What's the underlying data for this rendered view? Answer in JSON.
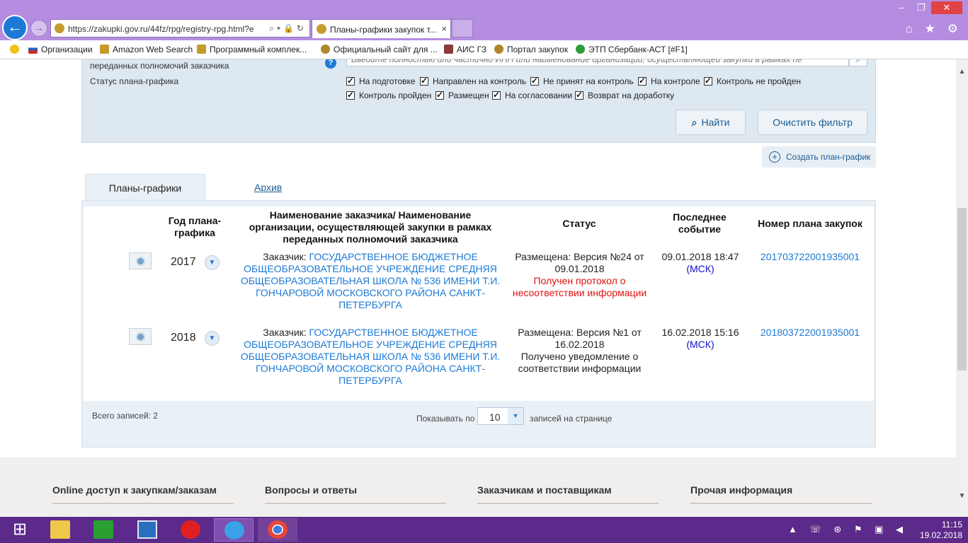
{
  "browser": {
    "url": "https://zakupki.gov.ru/44fz/rpg/registry-rpg.html?е",
    "tab_title": "Планы-графики закупок т...",
    "tab_close": "×",
    "window_controls": {
      "minimize": "–",
      "restore": "❐",
      "close": "✕"
    },
    "toolbar_icons": "⌂ ★ ⚙"
  },
  "favorites": [
    {
      "label": "Организации",
      "icon": "russia-flag-icon",
      "color": "#2c5fb8"
    },
    {
      "label": "Amazon Web Search",
      "icon": "ie-page-icon",
      "color": "#c69a2a"
    },
    {
      "label": "Программный комплек...",
      "icon": "ie-page-icon",
      "color": "#c69a2a"
    },
    {
      "label": "Официальный сайт для ...",
      "icon": "emblem-icon",
      "color": "#b0862a"
    },
    {
      "label": "АИС ГЗ",
      "icon": "tools-icon",
      "color": "#8a3a3a"
    },
    {
      "label": "Портал закупок",
      "icon": "emblem-icon",
      "color": "#b0862a"
    },
    {
      "label": "ЭТП Сбербанк-АСТ [#F1]",
      "icon": "sberbank-icon",
      "color": "#2d9b3a"
    }
  ],
  "filter": {
    "partial_label": "переданных полномочий заказчика",
    "status_label": "Статус плана-графика",
    "search_placeholder": "Введите полностью или частично ИНН или наименование организации, осуществляющей закупки в рамках пе",
    "help": "?",
    "statuses_row1": [
      "На подготовке",
      "Направлен на контроль",
      "Не принят на контроль",
      "На контроле",
      "Контроль не пройден"
    ],
    "statuses_row2": [
      "Контроль пройден",
      "Размещен",
      "На согласовании",
      "Возврат на доработку"
    ],
    "find_button": "Найти",
    "clear_button": "Очистить фильтр"
  },
  "create_plan": "Создать план-график",
  "tabs": {
    "plans": "Планы-графики",
    "archive": "Архив"
  },
  "table": {
    "headers": {
      "year": "Год плана-графика",
      "customer": "Наименование заказчика/ Наименование организации, осуществляющей закупки в рамках переданных полномочий заказчика",
      "status": "Статус",
      "last_event": "Последнее событие",
      "plan_number": "Номер плана закупок"
    },
    "rows": [
      {
        "year": "2017",
        "customer_prefix": "Заказчик: ",
        "customer_name": "ГОСУДАРСТВЕННОЕ БЮДЖЕТНОЕ ОБЩЕОБРАЗОВАТЕЛЬНОЕ УЧРЕЖДЕНИЕ СРЕДНЯЯ ОБЩЕОБРАЗОВАТЕЛЬНАЯ ШКОЛА № 536 ИМЕНИ Т.И. ГОНЧАРОВОЙ МОСКОВСКОГО РАЙОНА САНКТ-ПЕТЕРБУРГА",
        "status_main": "Размещена: Версия №24 от 09.01.2018",
        "status_note": "Получен протокол о несоответствии информации",
        "status_note_color": "#e01010",
        "event_time": "09.01.2018 18:47",
        "event_tz": "(МСК)",
        "plan_number": "201703722001935001"
      },
      {
        "year": "2018",
        "customer_prefix": "Заказчик: ",
        "customer_name": "ГОСУДАРСТВЕННОЕ БЮДЖЕТНОЕ ОБЩЕОБРАЗОВАТЕЛЬНОЕ УЧРЕЖДЕНИЕ СРЕДНЯЯ ОБЩЕОБРАЗОВАТЕЛЬНАЯ ШКОЛА № 536 ИМЕНИ Т.И. ГОНЧАРОВОЙ МОСКОВСКОГО РАЙОНА САНКТ-ПЕТЕРБУРГА",
        "status_main": "Размещена: Версия №1 от 16.02.2018",
        "status_note": "Получено уведомление о соответствии информации",
        "status_note_color": "#222222",
        "event_time": "16.02.2018 15:16",
        "event_tz": "(МСК)",
        "plan_number": "201803722001935001"
      }
    ]
  },
  "pagination": {
    "total": "Всего записей: 2",
    "show_label": "Показывать по",
    "page_size": "10",
    "per_page_label": "записей на странице"
  },
  "footer": [
    "Online доступ к закупкам/заказам",
    "Вопросы и ответы",
    "Заказчикам и поставщикам",
    "Прочая информация"
  ],
  "taskbar": {
    "time": "11:15",
    "date": "19.02.2018",
    "apps": [
      "start-icon",
      "file-explorer-icon",
      "store-icon",
      "lenovo-icon",
      "yandex-icon",
      "internet-explorer-icon",
      "chrome-icon"
    ]
  },
  "colors": {
    "accent": "#1c7ad6",
    "chrome": "#b58de0",
    "taskbar": "#5c2a8a",
    "alert": "#e01010"
  }
}
